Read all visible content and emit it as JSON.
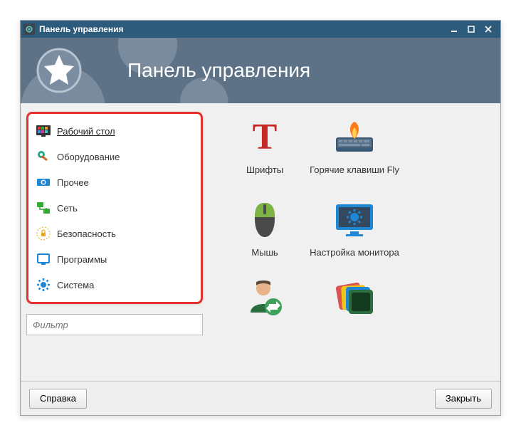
{
  "window": {
    "title": "Панель управления"
  },
  "banner": {
    "title": "Панель управления"
  },
  "sidebar": {
    "items": [
      {
        "label": "Рабочий стол",
        "icon": "desktop-icon",
        "selected": true
      },
      {
        "label": "Оборудование",
        "icon": "hardware-icon",
        "selected": false
      },
      {
        "label": "Прочее",
        "icon": "other-icon",
        "selected": false
      },
      {
        "label": "Сеть",
        "icon": "network-icon",
        "selected": false
      },
      {
        "label": "Безопасность",
        "icon": "security-icon",
        "selected": false
      },
      {
        "label": "Программы",
        "icon": "programs-icon",
        "selected": false
      },
      {
        "label": "Система",
        "icon": "system-icon",
        "selected": false
      }
    ]
  },
  "filter": {
    "placeholder": "Фильтр"
  },
  "apps": [
    {
      "label": "Шрифты",
      "icon": "fonts-icon"
    },
    {
      "label": "Горячие клавиши Fly",
      "icon": "hotkeys-icon"
    },
    {
      "label": "Мышь",
      "icon": "mouse-icon"
    },
    {
      "label": "Настройка монитора",
      "icon": "monitor-settings-icon"
    },
    {
      "label": "",
      "icon": "user-switch-icon"
    },
    {
      "label": "",
      "icon": "themes-icon"
    }
  ],
  "footer": {
    "help": "Справка",
    "close": "Закрыть"
  },
  "colors": {
    "titlebar": "#2d5b7b",
    "banner": "#5d7187",
    "highlight_border": "#e53030",
    "accent_blue": "#1e88d6"
  }
}
